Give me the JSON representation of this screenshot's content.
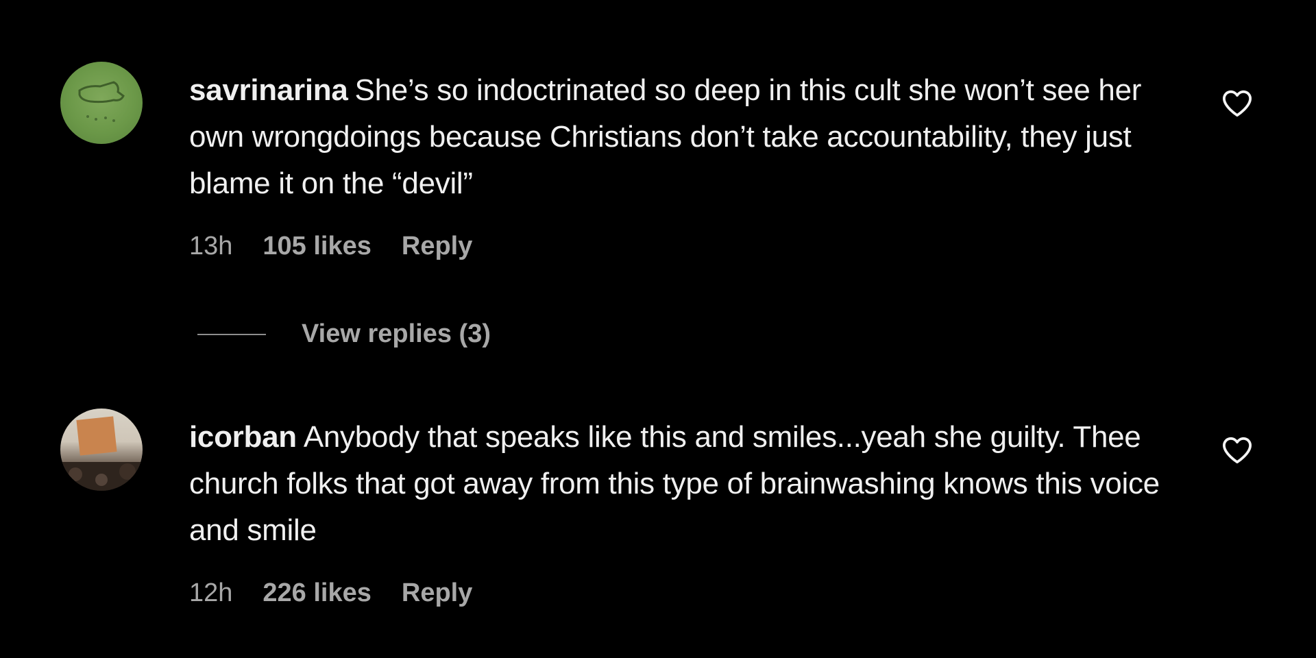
{
  "comments": [
    {
      "username": "savrinarina",
      "text": "She’s so indoctrinated so deep in this cult she won’t see her own wrongdoings because Christians don’t take accountability, they just blame it on the “devil”",
      "time": "13h",
      "likes": "105 likes",
      "reply_label": "Reply",
      "icon": "heart-outline-icon"
    },
    {
      "username": "icorban",
      "text": "Anybody that speaks like this and smiles...yeah she guilty. Thee church folks that got away from this type of brainwashing knows this voice and smile",
      "time": "12h",
      "likes": "226 likes",
      "reply_label": "Reply",
      "icon": "heart-outline-icon"
    }
  ],
  "view_replies_label": "View replies (3)",
  "colors": {
    "background": "#000000",
    "text": "#f0f0f0",
    "meta": "#a8a8a8"
  }
}
